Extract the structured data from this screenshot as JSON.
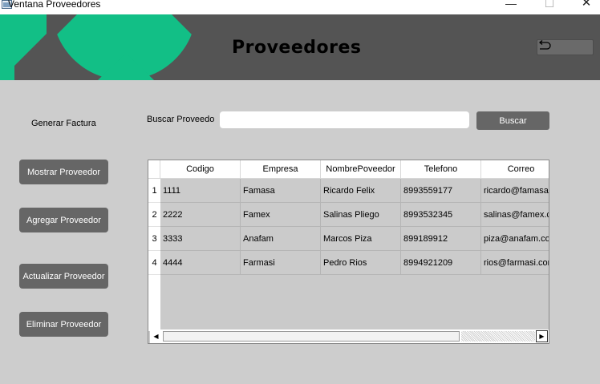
{
  "window": {
    "title": "Ventana Proveedores",
    "min_glyph": "—",
    "max_glyph": "☐",
    "close_glyph": "✕"
  },
  "header": {
    "title": "Proveedores",
    "back_icon": "undo-arrow-icon",
    "bg_color": "#545454",
    "accent_color": "#12bf86"
  },
  "sidebar": {
    "label": "Generar Factura",
    "buttons": [
      {
        "label": "Mostrar Proveedor"
      },
      {
        "label": "Agregar Proveedor"
      },
      {
        "label": "Actualizar Proveedor"
      },
      {
        "label": "Eliminar Proveedor"
      }
    ]
  },
  "search": {
    "label": "Buscar Proveedo",
    "value": "",
    "placeholder": "",
    "button_label": "Buscar"
  },
  "table": {
    "columns": [
      "Codigo",
      "Empresa",
      "NombrePoveedor",
      "Telefono",
      "Correo"
    ],
    "row_headers": [
      "1",
      "2",
      "3",
      "4"
    ],
    "rows": [
      [
        "1111",
        "Famasa",
        "Ricardo Felix",
        "8993559177",
        "ricardo@famasa.com"
      ],
      [
        "2222",
        "Famex",
        "Salinas Pliego",
        "8993532345",
        "salinas@famex.com"
      ],
      [
        "3333",
        "Anafam",
        "Marcos Piza",
        "899189912",
        "piza@anafam.com"
      ],
      [
        "4444",
        "Farmasi",
        "Pedro Rios",
        "8994921209",
        "rios@farmasi.com"
      ]
    ]
  }
}
